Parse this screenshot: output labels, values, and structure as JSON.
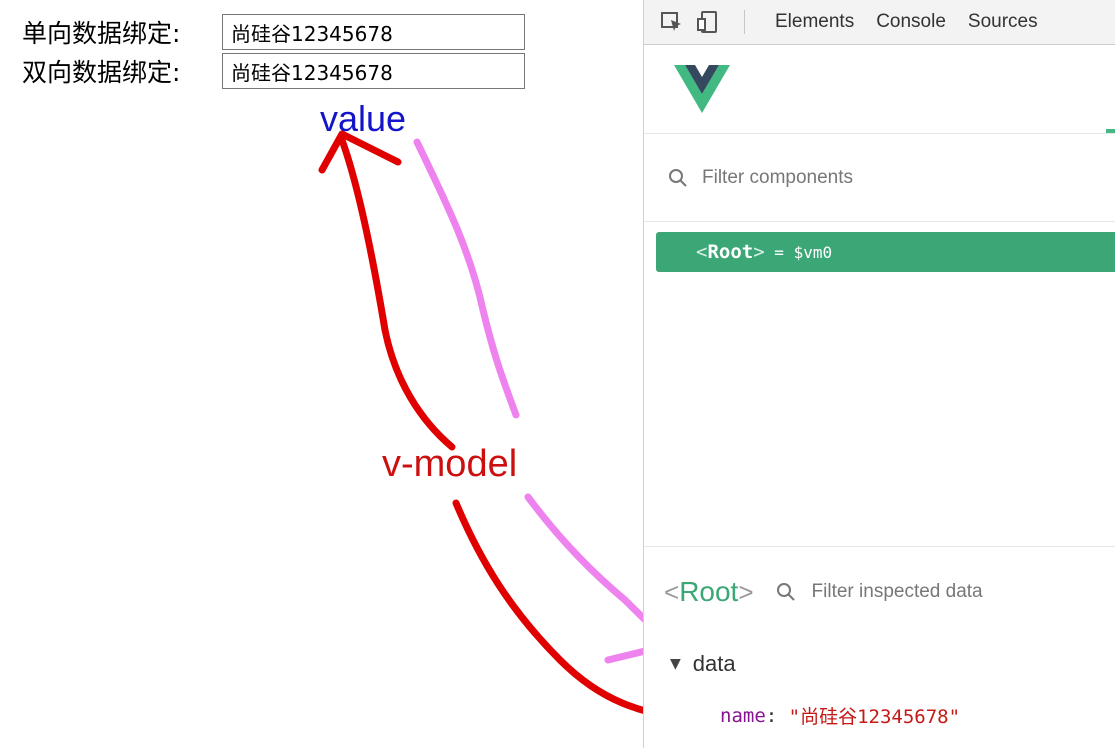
{
  "form": {
    "one_way_label": "单向数据绑定:",
    "one_way_value": "尚硅谷12345678",
    "two_way_label": "双向数据绑定:",
    "two_way_value": "尚硅谷12345678"
  },
  "annotations": {
    "value_label": "value",
    "vmodel_label": "v-model"
  },
  "devtools": {
    "tabs": [
      "Elements",
      "Console",
      "Sources"
    ],
    "filter_components_placeholder": "Filter components",
    "root_row": {
      "open": "<",
      "name": "Root",
      "close": ">",
      "eq": " = ",
      "ref": "$vm0"
    },
    "inspect": {
      "open": "<",
      "name": "Root",
      "close": ">",
      "filter_placeholder": "Filter inspected data"
    },
    "data_section": {
      "label": "data",
      "prop_key": "name",
      "prop_value": "\"尚硅谷12345678\""
    }
  },
  "colors": {
    "vue_green": "#42b983",
    "vue_dark": "#35495e",
    "root_row_bg": "#3ba776",
    "annot_blue": "#1414c8",
    "annot_red": "#cc1010",
    "arrow_red": "#e00000",
    "arrow_pink": "#ee82ee"
  }
}
